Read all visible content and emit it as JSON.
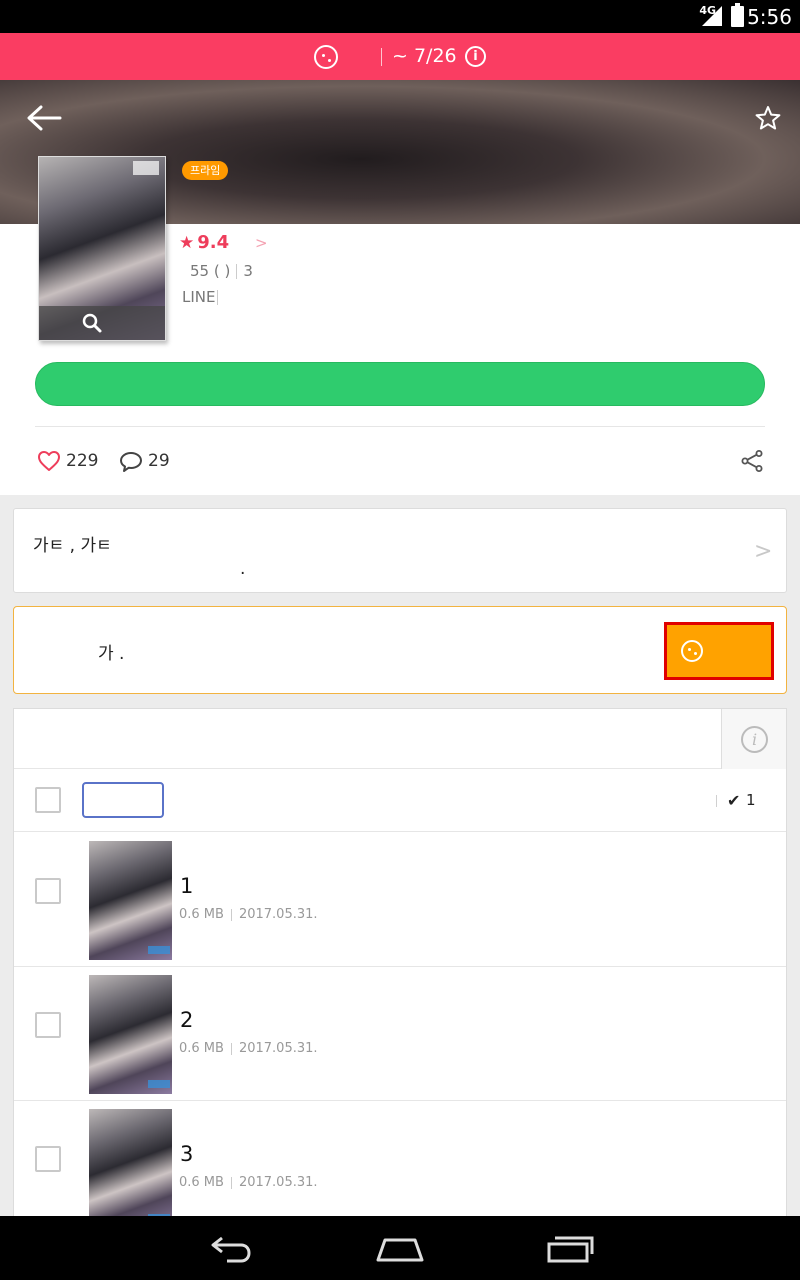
{
  "status_bar": {
    "network": "4G",
    "time": "5:56"
  },
  "promo": {
    "text": "~ 7/26"
  },
  "work": {
    "badge": "프라임",
    "rating": "9.4",
    "meta_count": "55 ( )",
    "meta_volumes": "3",
    "publisher": "LINE"
  },
  "actions": {
    "primary_button": "",
    "likes": "229",
    "comments": "29"
  },
  "description": {
    "line1": "가ㅌ   , 가ㅌ",
    "line2": "."
  },
  "cookie_notice": {
    "message": "가    .",
    "button_label": ""
  },
  "list": {
    "selected_count": "1",
    "episodes": [
      {
        "title": "1",
        "size": "0.6 MB",
        "date": "2017.05.31."
      },
      {
        "title": "2",
        "size": "0.6 MB",
        "date": "2017.05.31."
      },
      {
        "title": "3",
        "size": "0.6 MB",
        "date": "2017.05.31."
      }
    ]
  },
  "colors": {
    "brand_pink": "#fa3d62",
    "action_green": "#2fcc6e",
    "cookie_orange": "#ffa200",
    "rating_red": "#ee3d5b",
    "highlight_red": "#e00000"
  }
}
